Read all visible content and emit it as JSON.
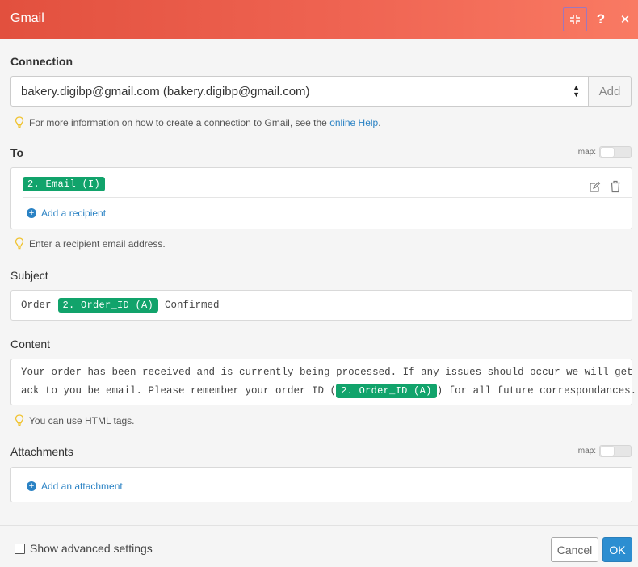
{
  "header": {
    "title": "Gmail",
    "collapse_icon": "collapse-icon",
    "help_label": "?",
    "close_label": "✕"
  },
  "connection": {
    "label": "Connection",
    "value": "bakery.digibp@gmail.com (bakery.digibp@gmail.com)",
    "add_label": "Add",
    "hint_text": "For more information on how to create a connection to Gmail, see the ",
    "hint_link": "online Help",
    "hint_end": "."
  },
  "to": {
    "label": "To",
    "map_label": "map:",
    "recipient_pill": "2. Email (I)",
    "add_recipient": "Add a recipient",
    "hint": "Enter a recipient email address."
  },
  "subject": {
    "label": "Subject",
    "prefix": "Order",
    "pill": "2. Order_ID (A)",
    "suffix": "Confirmed"
  },
  "content": {
    "label": "Content",
    "line1": "Your order has been received and is currently being processed. If any issues should occur we will get b",
    "line2_prefix": "ack to you be email. Please remember your order ID (",
    "pill": "2. Order_ID (A)",
    "line2_suffix": ") for all future correspondances.",
    "hint": "You can use HTML tags."
  },
  "attachments": {
    "label": "Attachments",
    "map_label": "map:",
    "add_attachment": "Add an attachment"
  },
  "footer": {
    "advanced_label": "Show advanced settings",
    "cancel_label": "Cancel",
    "ok_label": "OK"
  },
  "colors": {
    "header_start": "#e2503e",
    "header_end": "#f97a63",
    "pill_green": "#11a36b",
    "link_blue": "#2a82c4",
    "ok_blue": "#2c8ed1"
  }
}
